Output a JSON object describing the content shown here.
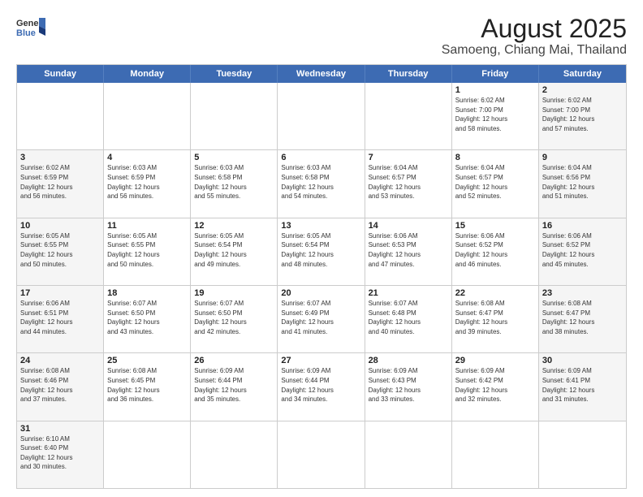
{
  "header": {
    "logo_general": "General",
    "logo_blue": "Blue",
    "title": "August 2025",
    "subtitle": "Samoeng, Chiang Mai, Thailand"
  },
  "weekdays": [
    "Sunday",
    "Monday",
    "Tuesday",
    "Wednesday",
    "Thursday",
    "Friday",
    "Saturday"
  ],
  "rows": [
    [
      {
        "day": "",
        "info": "",
        "type": "empty"
      },
      {
        "day": "",
        "info": "",
        "type": "empty"
      },
      {
        "day": "",
        "info": "",
        "type": "empty"
      },
      {
        "day": "",
        "info": "",
        "type": "empty"
      },
      {
        "day": "",
        "info": "",
        "type": "empty"
      },
      {
        "day": "1",
        "info": "Sunrise: 6:02 AM\nSunset: 7:00 PM\nDaylight: 12 hours\nand 58 minutes.",
        "type": "weekday"
      },
      {
        "day": "2",
        "info": "Sunrise: 6:02 AM\nSunset: 7:00 PM\nDaylight: 12 hours\nand 57 minutes.",
        "type": "weekend"
      }
    ],
    [
      {
        "day": "3",
        "info": "Sunrise: 6:02 AM\nSunset: 6:59 PM\nDaylight: 12 hours\nand 56 minutes.",
        "type": "weekend"
      },
      {
        "day": "4",
        "info": "Sunrise: 6:03 AM\nSunset: 6:59 PM\nDaylight: 12 hours\nand 56 minutes.",
        "type": "weekday"
      },
      {
        "day": "5",
        "info": "Sunrise: 6:03 AM\nSunset: 6:58 PM\nDaylight: 12 hours\nand 55 minutes.",
        "type": "weekday"
      },
      {
        "day": "6",
        "info": "Sunrise: 6:03 AM\nSunset: 6:58 PM\nDaylight: 12 hours\nand 54 minutes.",
        "type": "weekday"
      },
      {
        "day": "7",
        "info": "Sunrise: 6:04 AM\nSunset: 6:57 PM\nDaylight: 12 hours\nand 53 minutes.",
        "type": "weekday"
      },
      {
        "day": "8",
        "info": "Sunrise: 6:04 AM\nSunset: 6:57 PM\nDaylight: 12 hours\nand 52 minutes.",
        "type": "weekday"
      },
      {
        "day": "9",
        "info": "Sunrise: 6:04 AM\nSunset: 6:56 PM\nDaylight: 12 hours\nand 51 minutes.",
        "type": "weekend"
      }
    ],
    [
      {
        "day": "10",
        "info": "Sunrise: 6:05 AM\nSunset: 6:55 PM\nDaylight: 12 hours\nand 50 minutes.",
        "type": "weekend"
      },
      {
        "day": "11",
        "info": "Sunrise: 6:05 AM\nSunset: 6:55 PM\nDaylight: 12 hours\nand 50 minutes.",
        "type": "weekday"
      },
      {
        "day": "12",
        "info": "Sunrise: 6:05 AM\nSunset: 6:54 PM\nDaylight: 12 hours\nand 49 minutes.",
        "type": "weekday"
      },
      {
        "day": "13",
        "info": "Sunrise: 6:05 AM\nSunset: 6:54 PM\nDaylight: 12 hours\nand 48 minutes.",
        "type": "weekday"
      },
      {
        "day": "14",
        "info": "Sunrise: 6:06 AM\nSunset: 6:53 PM\nDaylight: 12 hours\nand 47 minutes.",
        "type": "weekday"
      },
      {
        "day": "15",
        "info": "Sunrise: 6:06 AM\nSunset: 6:52 PM\nDaylight: 12 hours\nand 46 minutes.",
        "type": "weekday"
      },
      {
        "day": "16",
        "info": "Sunrise: 6:06 AM\nSunset: 6:52 PM\nDaylight: 12 hours\nand 45 minutes.",
        "type": "weekend"
      }
    ],
    [
      {
        "day": "17",
        "info": "Sunrise: 6:06 AM\nSunset: 6:51 PM\nDaylight: 12 hours\nand 44 minutes.",
        "type": "weekend"
      },
      {
        "day": "18",
        "info": "Sunrise: 6:07 AM\nSunset: 6:50 PM\nDaylight: 12 hours\nand 43 minutes.",
        "type": "weekday"
      },
      {
        "day": "19",
        "info": "Sunrise: 6:07 AM\nSunset: 6:50 PM\nDaylight: 12 hours\nand 42 minutes.",
        "type": "weekday"
      },
      {
        "day": "20",
        "info": "Sunrise: 6:07 AM\nSunset: 6:49 PM\nDaylight: 12 hours\nand 41 minutes.",
        "type": "weekday"
      },
      {
        "day": "21",
        "info": "Sunrise: 6:07 AM\nSunset: 6:48 PM\nDaylight: 12 hours\nand 40 minutes.",
        "type": "weekday"
      },
      {
        "day": "22",
        "info": "Sunrise: 6:08 AM\nSunset: 6:47 PM\nDaylight: 12 hours\nand 39 minutes.",
        "type": "weekday"
      },
      {
        "day": "23",
        "info": "Sunrise: 6:08 AM\nSunset: 6:47 PM\nDaylight: 12 hours\nand 38 minutes.",
        "type": "weekend"
      }
    ],
    [
      {
        "day": "24",
        "info": "Sunrise: 6:08 AM\nSunset: 6:46 PM\nDaylight: 12 hours\nand 37 minutes.",
        "type": "weekend"
      },
      {
        "day": "25",
        "info": "Sunrise: 6:08 AM\nSunset: 6:45 PM\nDaylight: 12 hours\nand 36 minutes.",
        "type": "weekday"
      },
      {
        "day": "26",
        "info": "Sunrise: 6:09 AM\nSunset: 6:44 PM\nDaylight: 12 hours\nand 35 minutes.",
        "type": "weekday"
      },
      {
        "day": "27",
        "info": "Sunrise: 6:09 AM\nSunset: 6:44 PM\nDaylight: 12 hours\nand 34 minutes.",
        "type": "weekday"
      },
      {
        "day": "28",
        "info": "Sunrise: 6:09 AM\nSunset: 6:43 PM\nDaylight: 12 hours\nand 33 minutes.",
        "type": "weekday"
      },
      {
        "day": "29",
        "info": "Sunrise: 6:09 AM\nSunset: 6:42 PM\nDaylight: 12 hours\nand 32 minutes.",
        "type": "weekday"
      },
      {
        "day": "30",
        "info": "Sunrise: 6:09 AM\nSunset: 6:41 PM\nDaylight: 12 hours\nand 31 minutes.",
        "type": "weekend"
      }
    ],
    [
      {
        "day": "31",
        "info": "Sunrise: 6:10 AM\nSunset: 6:40 PM\nDaylight: 12 hours\nand 30 minutes.",
        "type": "weekend"
      },
      {
        "day": "",
        "info": "",
        "type": "empty"
      },
      {
        "day": "",
        "info": "",
        "type": "empty"
      },
      {
        "day": "",
        "info": "",
        "type": "empty"
      },
      {
        "day": "",
        "info": "",
        "type": "empty"
      },
      {
        "day": "",
        "info": "",
        "type": "empty"
      },
      {
        "day": "",
        "info": "",
        "type": "empty"
      }
    ]
  ]
}
